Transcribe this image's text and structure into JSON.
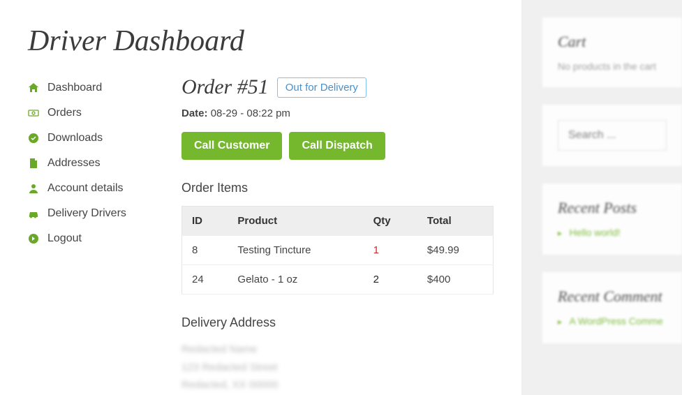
{
  "page_title": "Driver Dashboard",
  "nav": [
    {
      "label": "Dashboard",
      "icon": "home"
    },
    {
      "label": "Orders",
      "icon": "money"
    },
    {
      "label": "Downloads",
      "icon": "check-circle"
    },
    {
      "label": "Addresses",
      "icon": "file"
    },
    {
      "label": "Account details",
      "icon": "user"
    },
    {
      "label": "Delivery Drivers",
      "icon": "car"
    },
    {
      "label": "Logout",
      "icon": "arrow-right-circle"
    }
  ],
  "order": {
    "heading": "Order #51",
    "status": "Out for Delivery",
    "date_label": "Date:",
    "date_value": "08-29 - 08:22 pm",
    "call_customer": "Call Customer",
    "call_dispatch": "Call Dispatch",
    "items_title": "Order Items",
    "columns": {
      "id": "ID",
      "product": "Product",
      "qty": "Qty",
      "total": "Total"
    },
    "rows": [
      {
        "id": "8",
        "product": "Testing Tincture",
        "qty": "1",
        "qty_highlight": true,
        "total": "$49.99"
      },
      {
        "id": "24",
        "product": "Gelato - 1 oz",
        "qty": "2",
        "qty_highlight": false,
        "total": "$400"
      }
    ],
    "address_title": "Delivery Address",
    "address_lines": [
      "Redacted Name",
      "123 Redacted Street",
      "Redacted, XX 00000"
    ]
  },
  "sidebar": {
    "cart_title": "Cart",
    "cart_empty": "No products in the cart",
    "search_placeholder": "Search ...",
    "recent_posts_title": "Recent Posts",
    "recent_post_link": "Hello world!",
    "recent_comments_title": "Recent Comment",
    "recent_comment_link": "A WordPress Comme"
  }
}
